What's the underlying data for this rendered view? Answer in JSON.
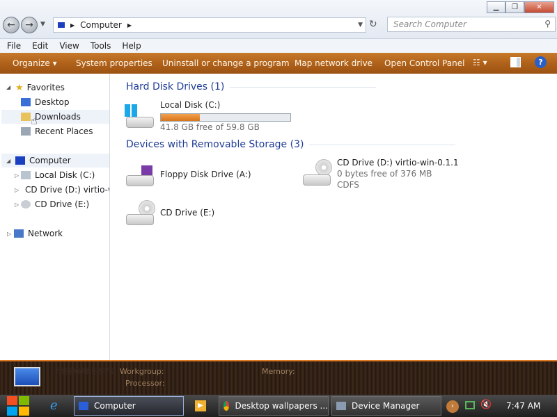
{
  "address": {
    "crumb": "Computer"
  },
  "search": {
    "placeholder": "Search Computer"
  },
  "menu": [
    "File",
    "Edit",
    "View",
    "Tools",
    "Help"
  ],
  "commands": {
    "organize": "Organize",
    "system_properties": "System properties",
    "uninstall": "Uninstall or change a program",
    "map_drive": "Map network drive",
    "control_panel": "Open Control Panel"
  },
  "nav": {
    "favorites": "Favorites",
    "desktop": "Desktop",
    "downloads": "Downloads",
    "recent": "Recent Places",
    "computer": "Computer",
    "local_disk": "Local Disk (C:)",
    "cd_d": "CD Drive (D:) virtio-w",
    "cd_e": "CD Drive (E:)",
    "network": "Network"
  },
  "groups": {
    "hard_disks": "Hard Disk Drives (1)",
    "removable": "Devices with Removable Storage (3)"
  },
  "drives": {
    "c": {
      "name": "Local Disk (C:)",
      "free": "41.8 GB free of 59.8 GB",
      "used_fraction": 0.3
    },
    "floppy": {
      "name": "Floppy Disk Drive (A:)"
    },
    "d": {
      "name": "CD Drive (D:) virtio-win-0.1.1",
      "free": "0 bytes free of 376 MB",
      "fs": "CDFS"
    },
    "e": {
      "name": "CD Drive (E:)"
    }
  },
  "details": {
    "name": "FREEWARE-SYS",
    "workgroup_label": "Workgroup:",
    "memory_label": "Memory:",
    "processor_label": "Processor:"
  },
  "taskbar": {
    "computer": "Computer",
    "chrome": "Desktop wallpapers ...",
    "devmgr": "Device Manager",
    "clock": "7:47 AM"
  },
  "colors": {
    "accent": "#c06e24",
    "group_heading": "#1e3c96",
    "disk_fill": "#e0802a"
  }
}
